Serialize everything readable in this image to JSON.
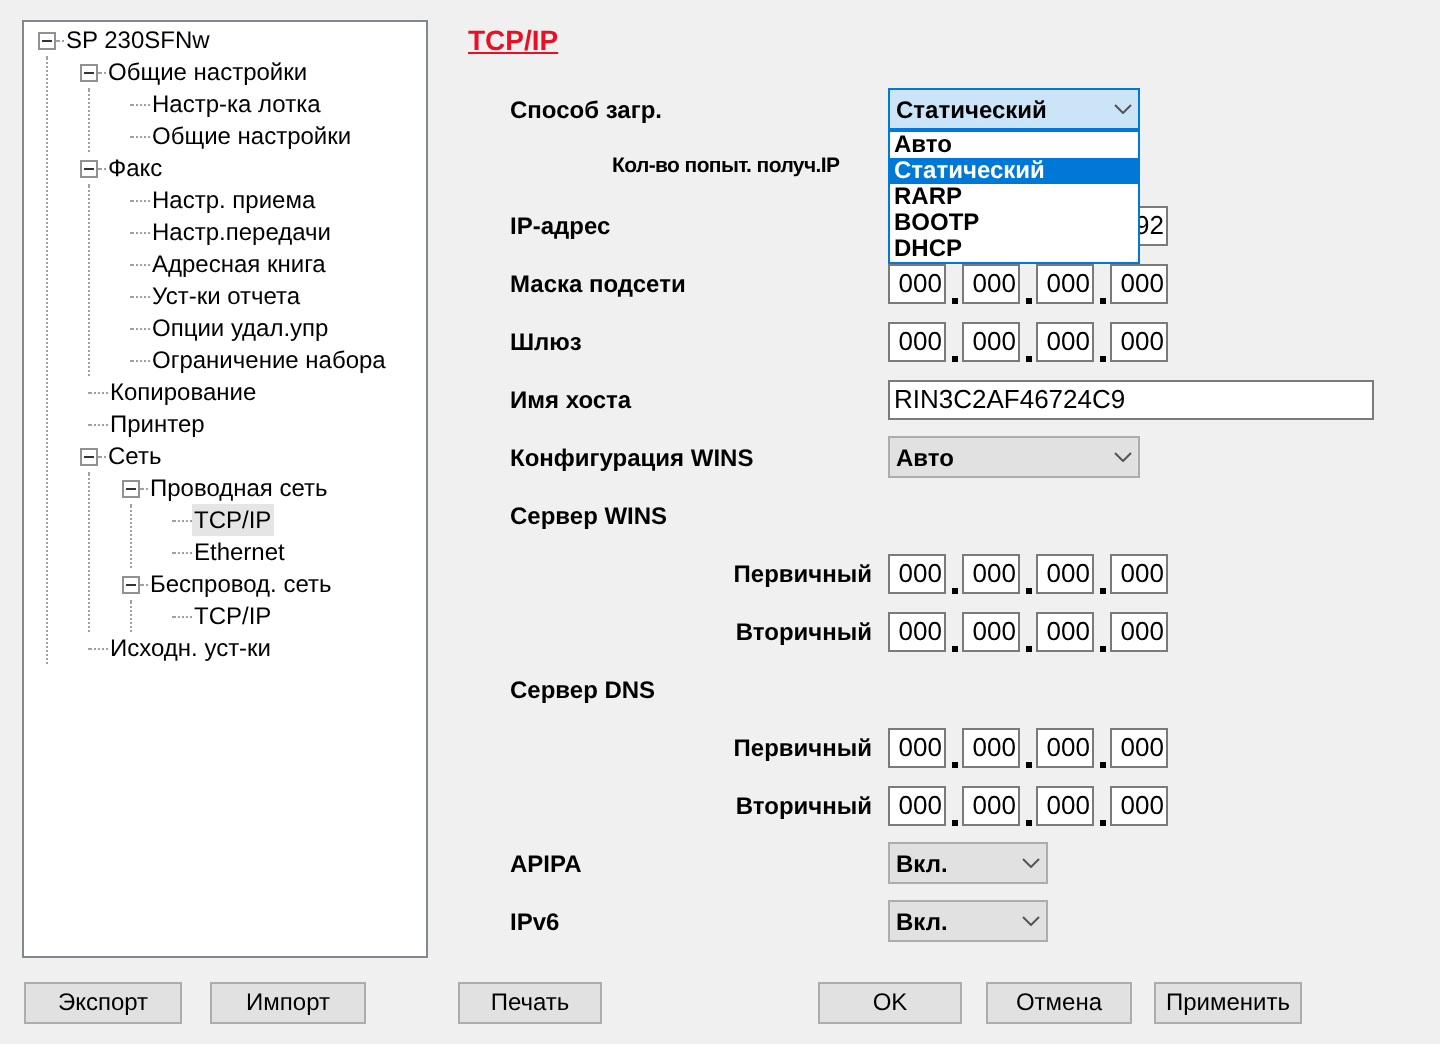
{
  "tree": [
    {
      "label": "SP 230SFNw",
      "expanded": true,
      "selected": false,
      "children": [
        {
          "label": "Общие настройки",
          "expanded": true,
          "selected": false,
          "children": [
            {
              "label": "Настр-ка лотка",
              "selected": false
            },
            {
              "label": "Общие настройки",
              "selected": false
            }
          ]
        },
        {
          "label": "Факс",
          "expanded": true,
          "selected": false,
          "children": [
            {
              "label": "Настр. приема",
              "selected": false
            },
            {
              "label": "Настр.передачи",
              "selected": false
            },
            {
              "label": "Адресная книга",
              "selected": false
            },
            {
              "label": "Уст-ки отчета",
              "selected": false
            },
            {
              "label": "Опции удал.упр",
              "selected": false
            },
            {
              "label": "Ограничение набора",
              "selected": false
            }
          ]
        },
        {
          "label": "Копирование",
          "selected": false
        },
        {
          "label": "Принтер",
          "selected": false
        },
        {
          "label": "Сеть",
          "expanded": true,
          "selected": false,
          "children": [
            {
              "label": "Проводная сеть",
              "expanded": true,
              "selected": false,
              "children": [
                {
                  "label": "TCP/IP",
                  "selected": true
                },
                {
                  "label": "Ethernet",
                  "selected": false
                }
              ]
            },
            {
              "label": "Беспровод. сеть",
              "expanded": true,
              "selected": false,
              "children": [
                {
                  "label": "TCP/IP",
                  "selected": false
                }
              ]
            }
          ]
        },
        {
          "label": "Исходн. уст-ки",
          "selected": false
        }
      ]
    }
  ],
  "heading": "TCP/IP",
  "fields": [
    {
      "kind": "select",
      "label": "Способ загр.",
      "value": "Статический",
      "expanded": true,
      "options": [
        {
          "label": "Авто",
          "selected": false
        },
        {
          "label": "Статический",
          "selected": true
        },
        {
          "label": "RARP",
          "selected": false
        },
        {
          "label": "BOOTP",
          "selected": false
        },
        {
          "label": "DHCP",
          "selected": false
        }
      ]
    },
    {
      "kind": "indented_label",
      "label": "Кол-во попыт. получ.IP"
    },
    {
      "kind": "ip_tail",
      "label": "IP-адрес",
      "tail": "92"
    },
    {
      "kind": "ip",
      "label": "Маска подсети",
      "octets": [
        "000",
        "000",
        "000",
        "000"
      ]
    },
    {
      "kind": "ip",
      "label": "Шлюз",
      "octets": [
        "000",
        "000",
        "000",
        "000"
      ]
    },
    {
      "kind": "text",
      "label": "Имя хоста",
      "value": "RIN3C2AF46724C9"
    },
    {
      "kind": "select",
      "label": "Конфигурация WINS",
      "value": "Авто",
      "expanded": false
    },
    {
      "kind": "section",
      "label": "Сервер WINS"
    },
    {
      "kind": "sub_ip",
      "label": "Первичный",
      "octets": [
        "000",
        "000",
        "000",
        "000"
      ]
    },
    {
      "kind": "sub_ip",
      "label": "Вторичный",
      "octets": [
        "000",
        "000",
        "000",
        "000"
      ]
    },
    {
      "kind": "section",
      "label": "Сервер DNS"
    },
    {
      "kind": "sub_ip",
      "label": "Первичный",
      "octets": [
        "000",
        "000",
        "000",
        "000"
      ]
    },
    {
      "kind": "sub_ip",
      "label": "Вторичный",
      "octets": [
        "000",
        "000",
        "000",
        "000"
      ]
    },
    {
      "kind": "short_select",
      "label": "APIPA",
      "value": "Вкл.",
      "expanded": false
    },
    {
      "kind": "short_select",
      "label": "IPv6",
      "value": "Вкл.",
      "expanded": false
    }
  ],
  "buttons": [
    {
      "label": "Экспорт"
    },
    {
      "label": "Импорт"
    },
    {
      "label": "Печать"
    },
    {
      "label": "OK"
    },
    {
      "label": "Отмена"
    },
    {
      "label": "Применить"
    }
  ]
}
